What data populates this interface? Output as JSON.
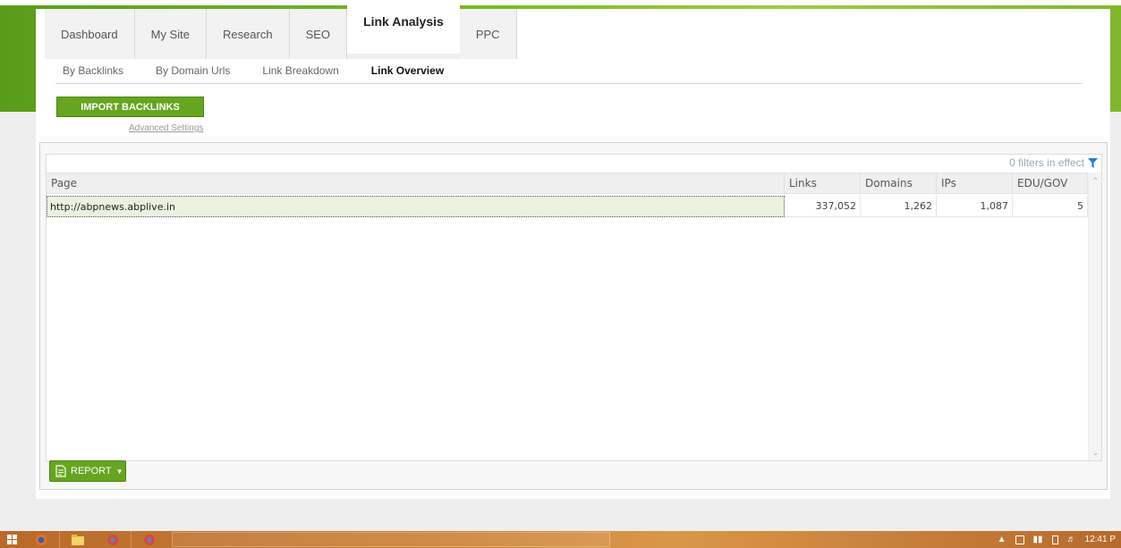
{
  "main_tabs": [
    "Dashboard",
    "My Site",
    "Research",
    "SEO",
    "Link Analysis",
    "PPC"
  ],
  "active_main_tab": "Link Analysis",
  "sub_tabs": [
    "By Backlinks",
    "By Domain Urls",
    "Link Breakdown",
    "Link Overview"
  ],
  "active_sub_tab": "Link Overview",
  "import_button": "IMPORT BACKLINKS",
  "advanced_settings": "Advanced Settings",
  "filters_text": "0 filters in effect",
  "table": {
    "headers": [
      "Page",
      "Links",
      "Domains",
      "IPs",
      "EDU/GOV"
    ],
    "rows": [
      {
        "page": "http://abpnews.abplive.in",
        "links": "337,052",
        "domains": "1,262",
        "ips": "1,087",
        "edu_gov": "5"
      }
    ]
  },
  "report_button": "REPORT",
  "taskbar": {
    "apps": [
      "windows-start",
      "firefox",
      "file-explorer",
      "chrome",
      "chrome"
    ],
    "time": "12:41 P"
  },
  "colors": {
    "brand_green": "#66a51f",
    "header_band": "#7cb82a",
    "taskbar": "#cc8438",
    "filter_icon": "#1a7ed6"
  }
}
